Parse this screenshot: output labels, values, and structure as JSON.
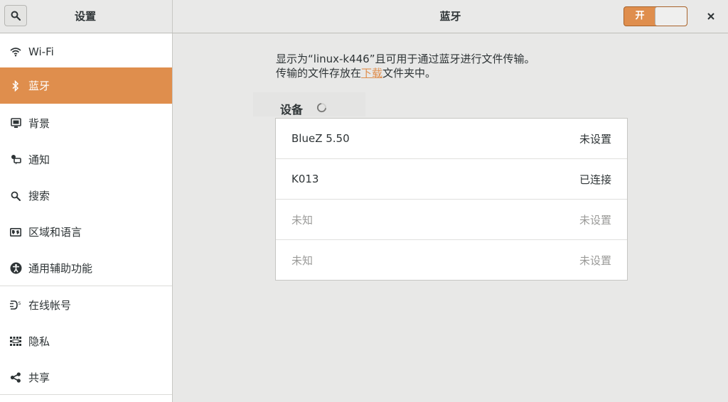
{
  "window": {
    "sidebar_title": "设置",
    "panel_title": "蓝牙",
    "toggle_label": "开",
    "toggle_state": "on"
  },
  "sidebar": {
    "items": [
      {
        "label": "Wi-Fi",
        "icon": "wifi-icon"
      },
      {
        "label": "蓝牙",
        "icon": "bluetooth-icon",
        "active": true
      },
      {
        "label": "背景",
        "icon": "background-icon"
      },
      {
        "label": "通知",
        "icon": "notification-icon"
      },
      {
        "label": "搜索",
        "icon": "search-icon"
      },
      {
        "label": "区域和语言",
        "icon": "region-icon"
      },
      {
        "label": "通用辅助功能",
        "icon": "accessibility-icon"
      },
      {
        "label": "在线帐号",
        "icon": "online-accounts-icon"
      },
      {
        "label": "隐私",
        "icon": "privacy-icon"
      },
      {
        "label": "共享",
        "icon": "share-icon"
      }
    ]
  },
  "bluetooth": {
    "description_line1": "显示为“linux-k446”且可用于通过蓝牙进行文件传输。",
    "description_line2_prefix": "传输的文件存放在",
    "description_link": "下载",
    "description_line2_suffix": "文件夹中。",
    "devices_title": "设备",
    "devices": [
      {
        "name": "BlueZ 5.50",
        "status": "未设置",
        "dim": false
      },
      {
        "name": "K013",
        "status": "已连接",
        "dim": false
      },
      {
        "name": "未知",
        "status": "未设置",
        "dim": true
      },
      {
        "name": "未知",
        "status": "未设置",
        "dim": true
      }
    ]
  },
  "colors": {
    "accent": "#df8e4d",
    "sidebar_bg": "#ffffff",
    "content_bg": "#e8e8e7"
  }
}
